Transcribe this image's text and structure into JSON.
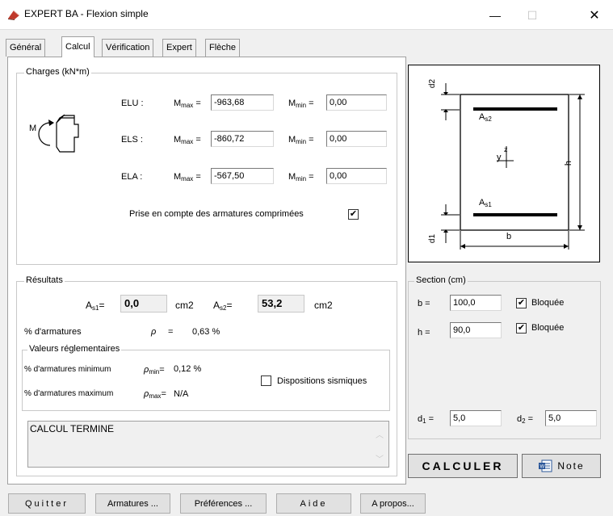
{
  "window": {
    "title": "EXPERT BA - Flexion simple",
    "minimize": "—",
    "maximize": "☐",
    "close": "✕"
  },
  "tabs": [
    "Général",
    "Calcul",
    "Vérification",
    "Expert",
    "Flèche"
  ],
  "charges": {
    "title": "Charges (kN*m)",
    "moment_label": "M",
    "elu_label": "ELU :",
    "els_label": "ELS :",
    "ela_label": "ELA :",
    "mmax_label": "M",
    "mmax_sub": "max",
    "mmin_label": "M",
    "mmin_sub": "min",
    "eq": "=",
    "elu_mmax": "-963,68",
    "elu_mmin": "0,00",
    "els_mmax": "-860,72",
    "els_mmin": "0,00",
    "ela_mmax": "-567,50",
    "ela_mmin": "0,00",
    "prise_label": "Prise en compte des armatures comprimées",
    "prise_checked": "✔"
  },
  "resultats": {
    "title": "Résultats",
    "as1_label": "A",
    "as1_sub": "s1",
    "as1_eq": "=",
    "as1_value": "0,0",
    "as2_label": "A",
    "as2_sub": "s2",
    "as2_eq": "=",
    "as2_value": "53,2",
    "unit": "cm2",
    "pct_label": "% d'armatures",
    "rho": "ρ",
    "rho_eq": "=",
    "rho_value": "0,63 %",
    "valeurs_title": "Valeurs réglementaires",
    "min_label": "% d'armatures minimum",
    "rho_min_sub": "min",
    "min_value": "0,12 %",
    "max_label": "% d'armatures maximum",
    "rho_max_sub": "max",
    "max_value": "N/A",
    "sismique_label": "Dispositions sismiques",
    "message": "CALCUL TERMINE"
  },
  "diagram": {
    "as2": "A",
    "as2_sub": "s2",
    "as1": "A",
    "as1_sub": "s1",
    "b": "b",
    "h": "h",
    "d1": "d1",
    "d2": "d2",
    "y": "y",
    "z": "z"
  },
  "section": {
    "title": "Section (cm)",
    "b_label": "b =",
    "b_value": "100,0",
    "b_bloquee": "Bloquée",
    "h_label": "h =",
    "h_value": "90,0",
    "h_bloquee": "Bloquée",
    "d1_label": "d",
    "d1_sub": "1",
    "d1_eq": "=",
    "d1_value": "5,0",
    "d2_label": "d",
    "d2_sub": "2",
    "d2_eq": "=",
    "d2_value": "5,0",
    "checked": "✔"
  },
  "actions": {
    "calculer": "CALCULER",
    "note": "Note"
  },
  "bottom_buttons": [
    "Quitter",
    "Armatures ...",
    "Préférences ...",
    "Aide",
    "A propos..."
  ],
  "colors": {
    "bar_fill": "#000000",
    "window_bg": "#f0f0f0",
    "app_icon": "#c0392b"
  }
}
